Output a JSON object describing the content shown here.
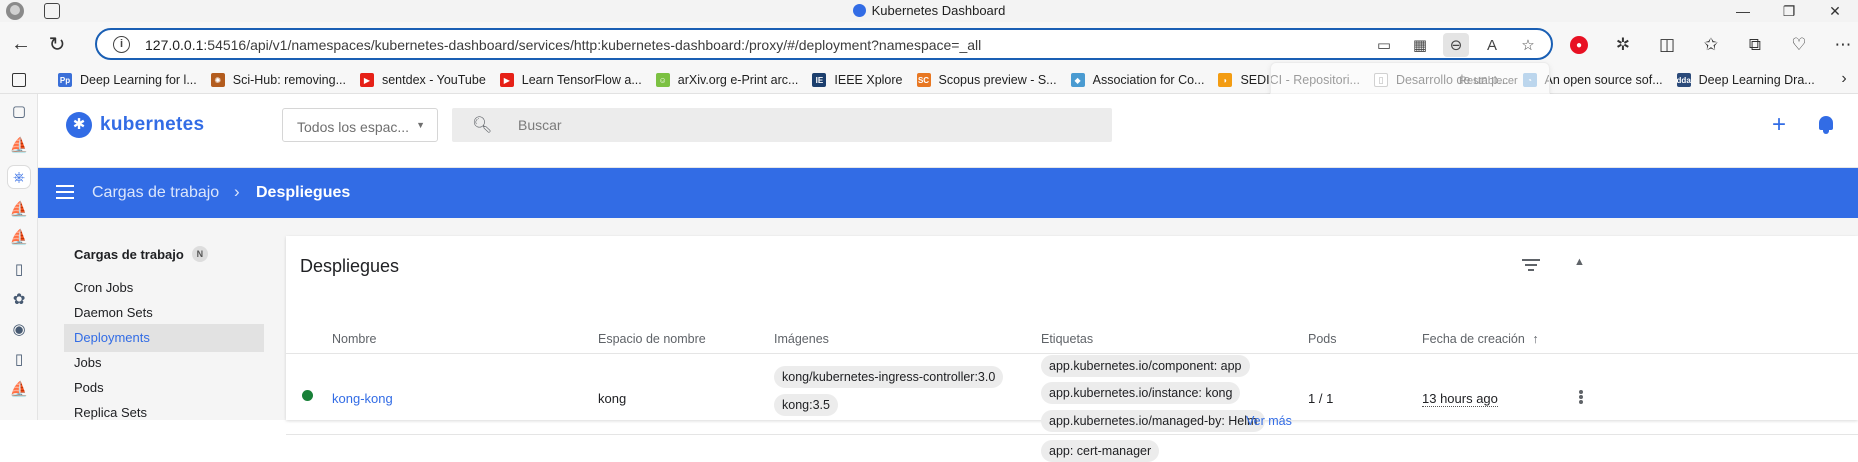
{
  "window": {
    "title": "Kubernetes Dashboard",
    "controls": [
      "—",
      "❐",
      "✕"
    ]
  },
  "addressbar": {
    "url_host": "127.0.0.1",
    "url_rest": ":54516/api/v1/namespaces/kubernetes-dashboard/services/http:kubernetes-dashboard:/proxy/#/deployment?namespace=_all",
    "back_icon": "arrow-left-icon",
    "reload_icon": "reload-icon"
  },
  "bookmarks": [
    {
      "label": "Deep Learning for l...",
      "color": "#3a6fd8",
      "glyph": "Pp"
    },
    {
      "label": "Sci-Hub: removing...",
      "color": "#b35c1e",
      "glyph": "✺"
    },
    {
      "label": "sentdex - YouTube",
      "color": "#e62117",
      "glyph": "▶"
    },
    {
      "label": "Learn TensorFlow a...",
      "color": "#e62117",
      "glyph": "▶"
    },
    {
      "label": "arXiv.org e-Print arc...",
      "color": "#7cc142",
      "glyph": "☺"
    },
    {
      "label": "IEEE Xplore",
      "color": "#1c3f6e",
      "glyph": "IE"
    },
    {
      "label": "Scopus preview - S...",
      "color": "#e87722",
      "glyph": "SC"
    },
    {
      "label": "Association for Co...",
      "color": "#4a9bd1",
      "glyph": "◆"
    },
    {
      "label": "SEDICI - Repositori...",
      "color": "#f39c12",
      "glyph": "◗"
    },
    {
      "label": "Desarrollo de un p...",
      "color": "#ffffff",
      "glyph": "▯"
    },
    {
      "label": "An open source sof...",
      "color": "#6aa5d8",
      "glyph": "◔"
    },
    {
      "label": "Deep Learning Dra...",
      "color": "#2b4a7a",
      "glyph": "dda"
    }
  ],
  "restore_popup": {
    "label": "Restablecer"
  },
  "app": {
    "logo": "kubernetes",
    "namespace_select": "Todos los espac...",
    "search_placeholder": "Buscar",
    "breadcrumb": {
      "parent": "Cargas de trabajo",
      "current": "Despliegues"
    }
  },
  "nav": {
    "heading": "Cargas de trabajo",
    "heading_badge": "N",
    "items": [
      "Cron Jobs",
      "Daemon Sets",
      "Deployments",
      "Jobs",
      "Pods",
      "Replica Sets"
    ],
    "active": "Deployments"
  },
  "table": {
    "title": "Despliegues",
    "columns": {
      "name": "Nombre",
      "namespace": "Espacio de nombre",
      "images": "Imágenes",
      "labels": "Etiquetas",
      "pods": "Pods",
      "created": "Fecha de creación"
    },
    "sort_indicator": "↑",
    "rows": [
      {
        "status": "running",
        "name": "kong-kong",
        "namespace": "kong",
        "images": [
          "kong/kubernetes-ingress-controller:3.0",
          "kong:3.5"
        ],
        "labels": [
          "app.kubernetes.io/component: app",
          "app.kubernetes.io/instance: kong",
          "app.kubernetes.io/managed-by: Helm"
        ],
        "more": "Ver más",
        "pods": "1 / 1",
        "created": "13 hours ago"
      },
      {
        "labels": [
          "app: cert-manager"
        ]
      }
    ]
  },
  "colors": {
    "accent": "#326ce5",
    "status_ok": "#188038",
    "url_border": "#1a5fb4"
  }
}
